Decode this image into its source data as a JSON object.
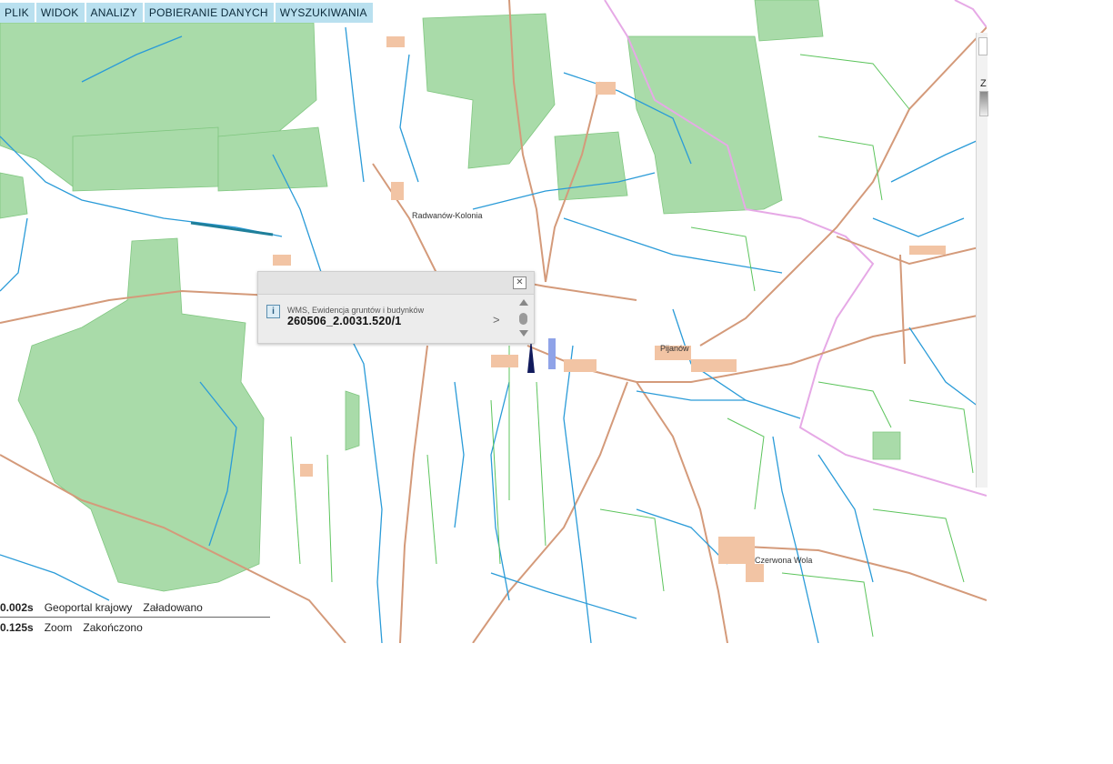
{
  "menu": [
    "PLIK",
    "WIDOK",
    "ANALIZY",
    "POBIERANIE DANYCH",
    "WYSZUKIWANIA"
  ],
  "places": {
    "radwanow": "Radwanów-Kolonia",
    "pijanow": "Pijanów",
    "czerwona_wola": "Czerwona Wola"
  },
  "popup": {
    "layer": "WMS, Ewidencja gruntów i budynków",
    "parcel_id": "260506_2.0031.520/1",
    "close_symbol": "✕",
    "next_symbol": ">"
  },
  "status": [
    {
      "time": "0.002s",
      "source": "Geoportal krajowy",
      "state": "Załadowano"
    },
    {
      "time": "0.125s",
      "source": "Zoom",
      "state": "Zakończono"
    }
  ],
  "sidebar": {
    "label": "Z"
  },
  "colors": {
    "forest": "#a9dba9",
    "water": "#2a9bd8",
    "road": "#d49a7a",
    "field": "#5cc45c",
    "boundary": "#e8a8e8",
    "building": "#f2c4a4",
    "menu_bg": "#b9e0ef"
  },
  "icons": [
    "info-icon",
    "close-icon",
    "chevron-right-icon",
    "scroll-up-icon",
    "scroll-down-icon"
  ]
}
